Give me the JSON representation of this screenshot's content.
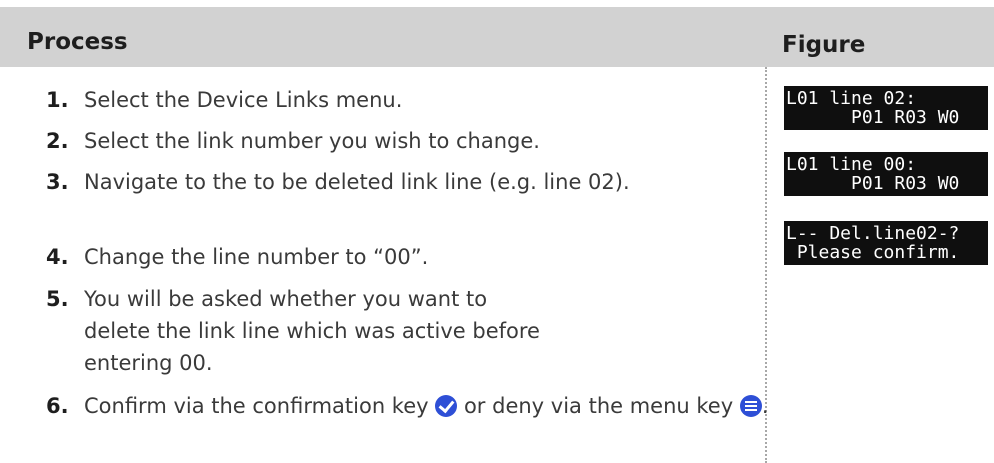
{
  "header": {
    "process": "Process",
    "figure": "Figure"
  },
  "steps": [
    {
      "num": "1.",
      "text": "Select the Device Links menu."
    },
    {
      "num": "2.",
      "text": "Select the link number you wish to change."
    },
    {
      "num": "3.",
      "text": "Navigate to the to be deleted link line (e.g. line 02)."
    },
    {
      "num": "4.",
      "text": "Change the line number to “00”."
    },
    {
      "num": "5.",
      "text": "You will be asked whether you want to delete the link line which was active before entering 00."
    },
    {
      "num": "6.",
      "text_before": "Confirm via the confirmation key",
      "text_middle": "or deny via the menu key",
      "text_end": "."
    }
  ],
  "figures": [
    {
      "line1": "L01 line 02:",
      "line2": "      P01 R03 W0"
    },
    {
      "line1": "L01 line 00:",
      "line2": "      P01 R03 W0"
    },
    {
      "line1": "L-- Del.line02-?",
      "line2": " Please confirm."
    }
  ],
  "icons": {
    "confirm": "check-circle-icon",
    "menu": "menu-lines-icon",
    "color": "#2e4fd6"
  }
}
